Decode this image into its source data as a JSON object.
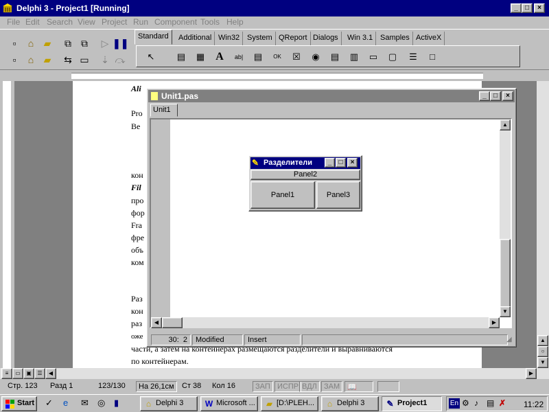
{
  "ide": {
    "title": "Delphi 3 - Project1 [Running]",
    "menu": [
      "File",
      "Edit",
      "Search",
      "View",
      "Project",
      "Run",
      "Component",
      "Tools",
      "Help"
    ],
    "palette_tabs": [
      "Standard",
      "Additional",
      "Win32",
      "System",
      "QReport",
      "Dialogs",
      "Win 3.1",
      "Samples",
      "ActiveX"
    ],
    "active_tab": "Standard"
  },
  "icons": {
    "ide": "delphi-icon",
    "editor": "file-icon",
    "form": "wrench-icon"
  },
  "word_doc": {
    "lines": [
      "Ali",
      "Pro",
      "Ве",
      "кон",
      "Fil",
      "про",
      "фор",
      "Fra",
      "фре",
      "объ",
      "ком",
      "Раз",
      "кон",
      "раз",
      "оже",
      "части, а затем на контейнерах размещаются разделители и выравниваются",
      "по контейнерам."
    ],
    "status": {
      "page": "Стр. 123",
      "section": "Разд 1",
      "pages": "123/130",
      "at": "На 26,1см",
      "line": "Ст 38",
      "col": "Кол 16",
      "rec": "ЗАП",
      "trk": "ИСПР",
      "ext": "ВДЛ",
      "ovr": "ЗАМ"
    }
  },
  "editor": {
    "title": "Unit1.pas",
    "tab": "Unit1",
    "position": "30:  2",
    "modified": "Modified",
    "mode": "Insert"
  },
  "form": {
    "title": "Разделители",
    "panel_top": "Panel2",
    "panel_left": "Panel1",
    "panel_right": "Panel3"
  },
  "taskbar": {
    "start": "Start",
    "tasks": [
      "Delphi 3",
      "Microsoft ...",
      "[D:\\PLEH...",
      "Delphi 3",
      "Project1"
    ],
    "lang": "En",
    "clock": "11:22"
  }
}
